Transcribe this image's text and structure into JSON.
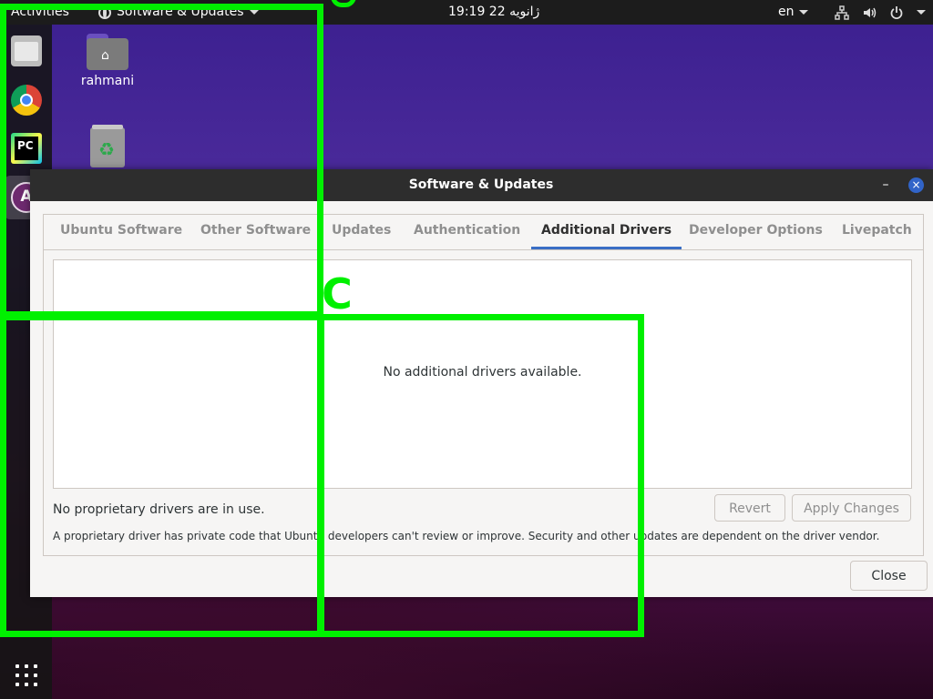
{
  "topbar": {
    "activities": "Activities",
    "app_menu": "Software & Updates",
    "clock": "19:19  22 ژانویه",
    "language": "en",
    "icons": [
      "network-icon",
      "volume-icon",
      "power-icon",
      "chevron-down-icon"
    ]
  },
  "dock": {
    "apps": [
      "files-icon",
      "chrome-icon",
      "pycharm-icon",
      "software-updates-icon"
    ],
    "pycharm_text": "PC",
    "show_apps": "grid-icon"
  },
  "desktop": {
    "home_label": "rahmani",
    "trash": "trash-icon"
  },
  "window": {
    "title": "Software & Updates",
    "minimize": "–",
    "close": "×",
    "tabs": [
      "Ubuntu Software",
      "Other Software",
      "Updates",
      "Authentication",
      "Additional Drivers",
      "Developer Options",
      "Livepatch"
    ],
    "active_tab": "Additional Drivers",
    "drivers_message": "No additional drivers available.",
    "status": "No proprietary drivers are in use.",
    "revert_label": "Revert",
    "apply_label": "Apply Changes",
    "note": "A proprietary driver has private code that Ubuntu developers can't review or improve. Security and other updates are dependent on the driver vendor.",
    "close_label": "Close"
  },
  "overlay": {
    "letter": "C",
    "color": "#00f000"
  },
  "colors": {
    "accent": "#3a6ec5",
    "titlebar": "#2d2d2d",
    "topbar": "#1c1c1c"
  }
}
